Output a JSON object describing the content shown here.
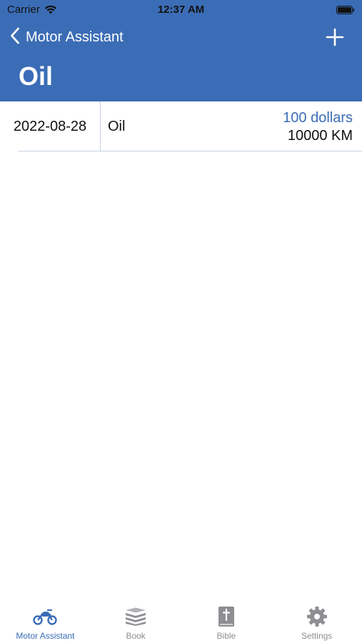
{
  "status_bar": {
    "carrier": "Carrier",
    "time": "12:37 AM"
  },
  "nav": {
    "back_label": "Motor Assistant",
    "title": "Oil"
  },
  "records": [
    {
      "date": "2022-08-28",
      "item": "Oil",
      "cost": "100 dollars",
      "mileage": "10000 KM"
    }
  ],
  "tabs": [
    {
      "label": "Motor Assistant",
      "icon": "motorcycle-icon",
      "active": true
    },
    {
      "label": "Book",
      "icon": "books-icon",
      "active": false
    },
    {
      "label": "Bible",
      "icon": "bible-icon",
      "active": false
    },
    {
      "label": "Settings",
      "icon": "gear-icon",
      "active": false
    }
  ],
  "colors": {
    "accent": "#3b6db6",
    "inactive": "#8e8e93"
  }
}
